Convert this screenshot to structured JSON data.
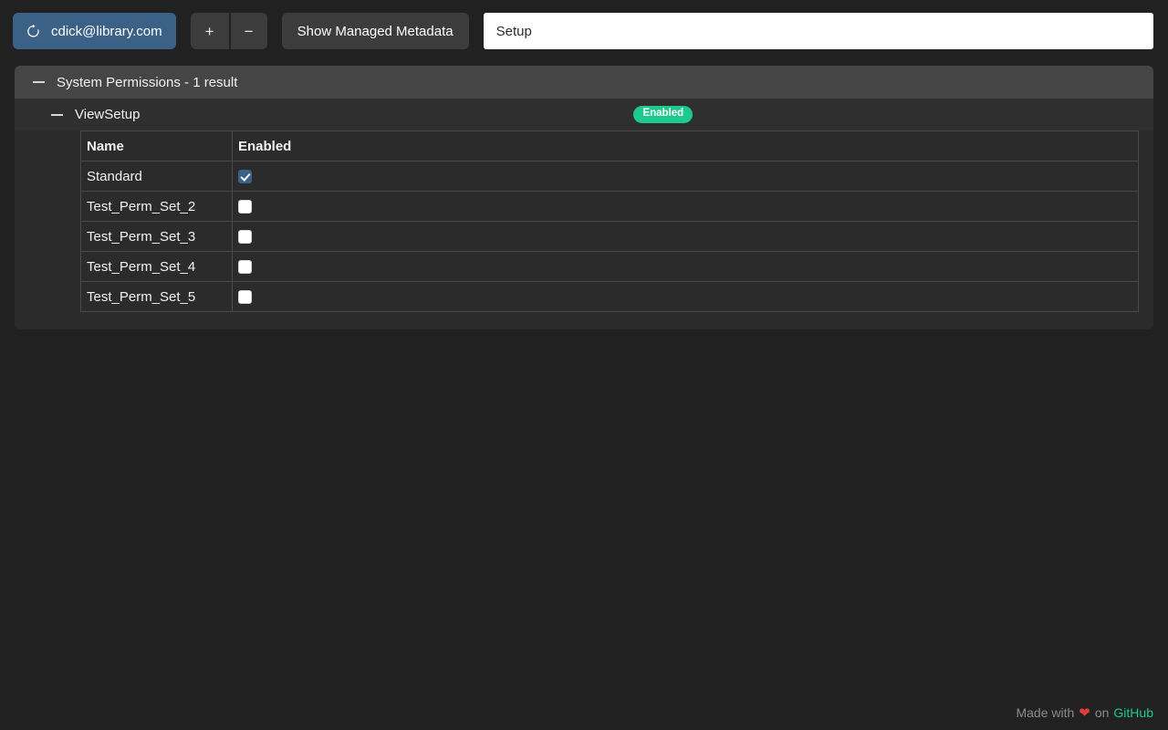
{
  "toolbar": {
    "user_button": {
      "label": "cdick@library.com",
      "icon": "refresh-icon"
    },
    "increase_button": {
      "label": "+",
      "icon": "plus-icon"
    },
    "decrease_button": {
      "label": "−",
      "icon": "minus-icon"
    },
    "metadata_button": {
      "label": "Show Managed Metadata"
    },
    "search": {
      "value": "Setup",
      "placeholder": "Setup"
    }
  },
  "panel": {
    "header": {
      "title": "System Permissions - 1 result",
      "collapse_icon": "minus-icon"
    },
    "group": {
      "name": "ViewSetup",
      "collapse_icon": "minus-icon",
      "badge": "Enabled"
    },
    "table": {
      "columns": [
        "Name",
        "Enabled"
      ],
      "rows": [
        {
          "name": "Standard",
          "enabled": true
        },
        {
          "name": "Test_Perm_Set_2",
          "enabled": false
        },
        {
          "name": "Test_Perm_Set_3",
          "enabled": false
        },
        {
          "name": "Test_Perm_Set_4",
          "enabled": false
        },
        {
          "name": "Test_Perm_Set_5",
          "enabled": false
        }
      ]
    }
  },
  "footer": {
    "made_with": "Made with",
    "heart": "❤",
    "on": "on",
    "link": "GitHub"
  },
  "colors": {
    "page_background": "#212121",
    "accent_blue": "#3b6186",
    "badge_green": "#1dc98d",
    "panel_header": "#454545",
    "panel_body": "#2b2b2b",
    "heart_red": "#e23b3b"
  }
}
